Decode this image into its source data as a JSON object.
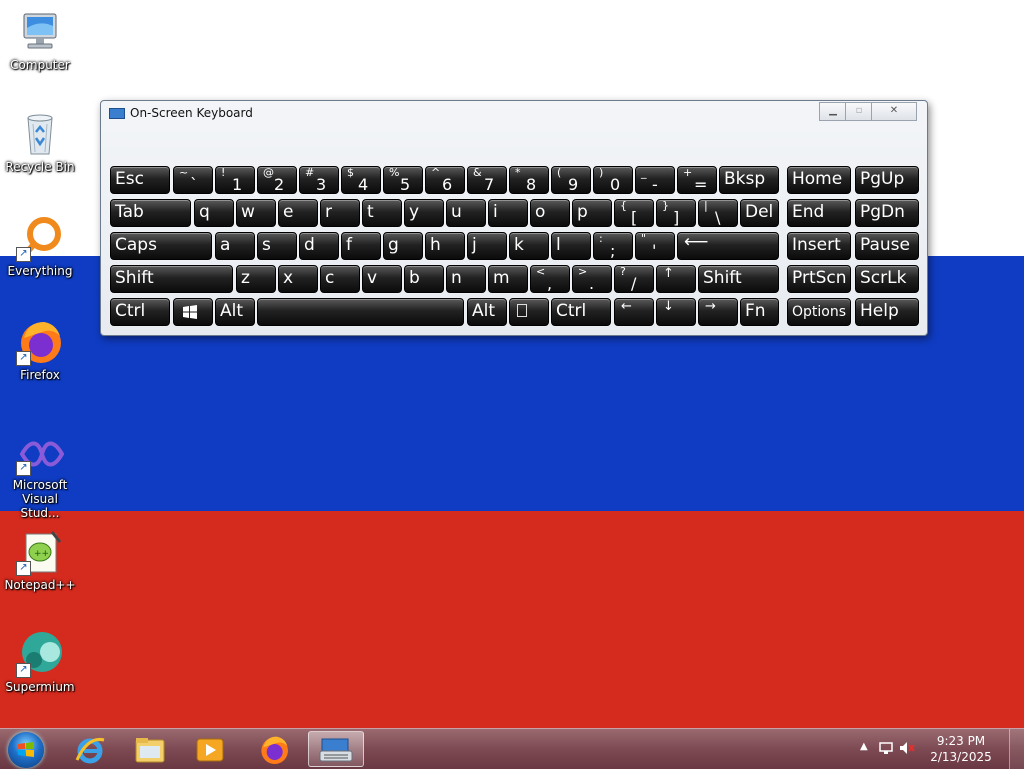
{
  "desktop": {
    "icons": [
      {
        "name": "computer",
        "label": "Computer"
      },
      {
        "name": "recycle-bin",
        "label": "Recycle Bin"
      },
      {
        "name": "everything",
        "label": "Everything"
      },
      {
        "name": "firefox",
        "label": "Firefox"
      },
      {
        "name": "visual-studio",
        "label": "Microsoft Visual Stud..."
      },
      {
        "name": "notepadpp",
        "label": "Notepad++"
      },
      {
        "name": "supermium",
        "label": "Supermium"
      }
    ]
  },
  "osk": {
    "title": "On-Screen Keyboard",
    "keys": {
      "esc": "Esc",
      "bksp": "Bksp",
      "tab": "Tab",
      "del": "Del",
      "caps": "Caps",
      "shift": "Shift",
      "ctrl": "Ctrl",
      "alt": "Alt",
      "fn": "Fn",
      "home": "Home",
      "pgup": "PgUp",
      "end": "End",
      "pgdn": "PgDn",
      "insert": "Insert",
      "pause": "Pause",
      "prtscn": "PrtScn",
      "scrlk": "ScrLk",
      "options": "Options",
      "help": "Help",
      "arrow_left": "←",
      "arrow_down": "↓",
      "arrow_right": "→",
      "arrow_up": "↑",
      "enter": "⟵",
      "row1": [
        {
          "s": "~",
          "b": "`"
        },
        {
          "s": "!",
          "b": "1"
        },
        {
          "s": "@",
          "b": "2"
        },
        {
          "s": "#",
          "b": "3"
        },
        {
          "s": "$",
          "b": "4"
        },
        {
          "s": "%",
          "b": "5"
        },
        {
          "s": "^",
          "b": "6"
        },
        {
          "s": "&",
          "b": "7"
        },
        {
          "s": "*",
          "b": "8"
        },
        {
          "s": "(",
          "b": "9"
        },
        {
          "s": ")",
          "b": "0"
        },
        {
          "s": "_",
          "b": "-"
        },
        {
          "s": "+",
          "b": "="
        }
      ],
      "row2": [
        "q",
        "w",
        "e",
        "r",
        "t",
        "y",
        "u",
        "i",
        "o",
        "p"
      ],
      "row2_punct": [
        {
          "s": "{",
          "b": "["
        },
        {
          "s": "}",
          "b": "]"
        },
        {
          "s": "|",
          "b": "\\"
        }
      ],
      "row3": [
        "a",
        "s",
        "d",
        "f",
        "g",
        "h",
        "j",
        "k",
        "l"
      ],
      "row3_punct": [
        {
          "s": ":",
          "b": ";"
        },
        {
          "s": "\"",
          "b": "'"
        }
      ],
      "row4": [
        "z",
        "x",
        "c",
        "v",
        "b",
        "n",
        "m"
      ],
      "row4_punct": [
        {
          "s": "<",
          "b": ","
        },
        {
          "s": ">",
          "b": "."
        },
        {
          "s": "?",
          "b": "/"
        }
      ]
    }
  },
  "taskbar": {
    "items": [
      "internet-explorer",
      "file-explorer",
      "media-player",
      "firefox",
      "on-screen-keyboard"
    ],
    "clock_time": "9:23 PM",
    "clock_date": "2/13/2025"
  },
  "colors": {
    "flag_white": "#ffffff",
    "flag_blue": "#0f3cc3",
    "flag_red": "#d52b1e",
    "taskbar": "#7d4a53"
  }
}
